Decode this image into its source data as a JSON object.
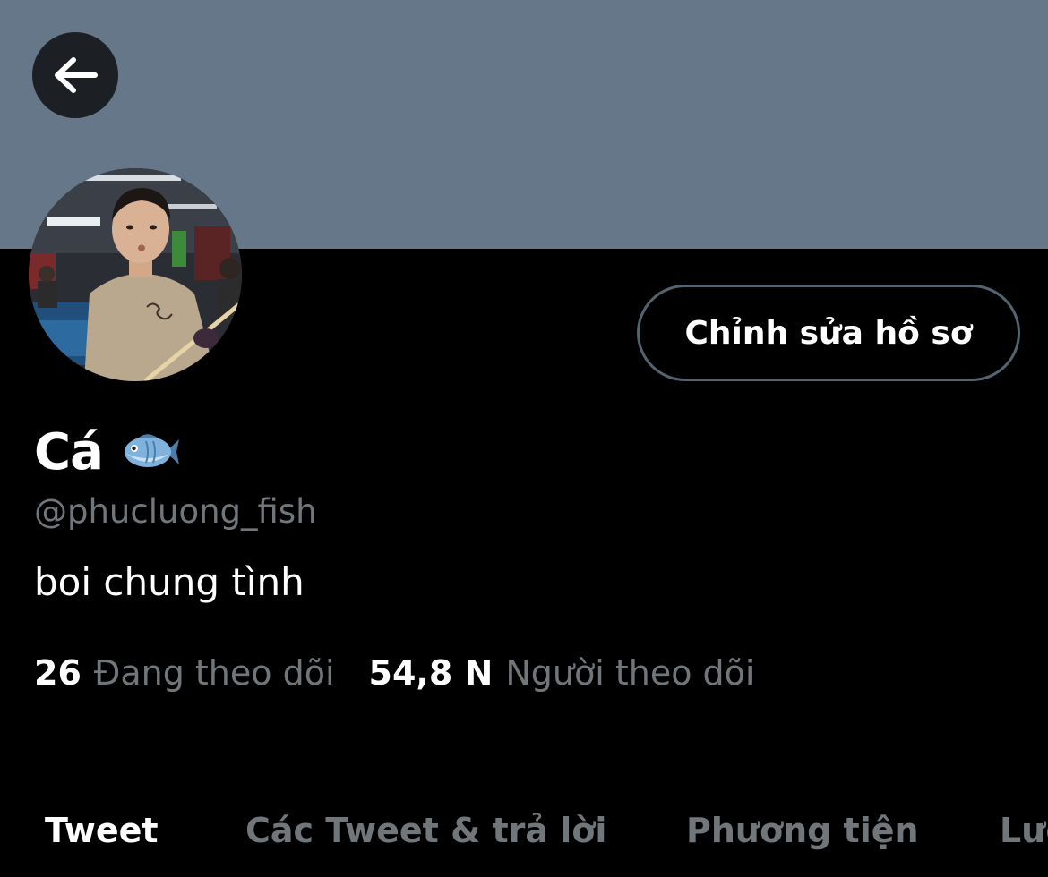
{
  "profile": {
    "display_name": "Cá",
    "name_emoji": "fish-icon",
    "handle": "@phucluong_fish",
    "bio": "boi chung tình",
    "edit_button_label": "Chỉnh sửa hồ sơ"
  },
  "stats": {
    "following_count": "26",
    "following_label": "Đang theo dõi",
    "followers_count": "54,8 N",
    "followers_label": "Người theo dõi"
  },
  "tabs": [
    {
      "label": "Tweet",
      "active": true
    },
    {
      "label": "Các Tweet & trả lời",
      "active": false
    },
    {
      "label": "Phương tiện",
      "active": false
    },
    {
      "label": "Lượt thích",
      "active": false
    }
  ],
  "colors": {
    "banner": "#66778a",
    "background": "#000000",
    "muted_text": "#71767b",
    "primary_text": "#ffffff",
    "button_border": "#536471"
  },
  "icons": {
    "back": "arrow-left-icon",
    "avatar": "profile-photo"
  }
}
